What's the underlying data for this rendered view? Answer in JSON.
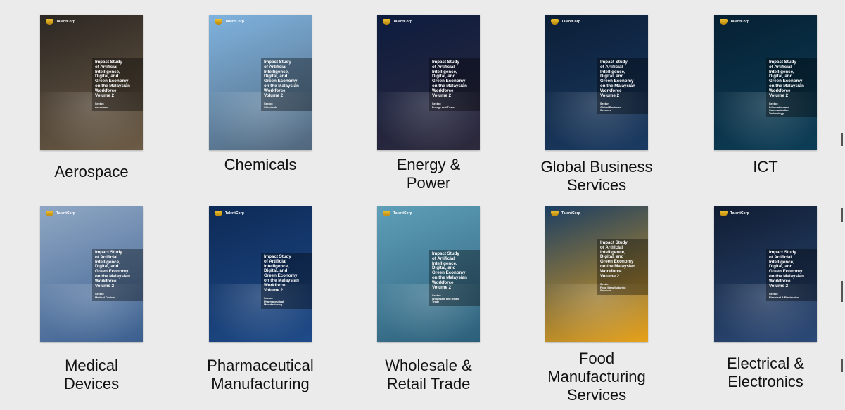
{
  "cover": {
    "brand": "TalentCorp",
    "title": "Impact Study\nof Artificial\nIntelligence,\nDigital, and\nGreen Economy\non the Malaysian\nWorkforce\nVolume 2"
  },
  "reports": [
    {
      "label": "Aerospace",
      "sector": "Sector:\nAerospace",
      "colors": [
        "#2c2723",
        "#6d5c46"
      ]
    },
    {
      "label": "Chemicals",
      "sector": "Sector:\nChemicals",
      "colors": [
        "#7fb3df",
        "#51677c"
      ]
    },
    {
      "label": "Energy &\nPower",
      "sector": "Sector:\nEnergy and Power",
      "colors": [
        "#0d1c3f",
        "#2e2a3d"
      ]
    },
    {
      "label": "Global Business\nServices",
      "sector": "Sector:\nGlobal Business\nServices",
      "colors": [
        "#0b1e37",
        "#1b3b62"
      ]
    },
    {
      "label": "ICT",
      "sector": "Sector:\nInformation and\nCommunication\nTechnology",
      "colors": [
        "#062033",
        "#0d3e57"
      ]
    },
    {
      "label": "Medical\nDevices",
      "sector": "Sector:\nMedical Devices",
      "colors": [
        "#8fa7c4",
        "#3b5f8f"
      ]
    },
    {
      "label": "Pharmaceutical\nManufacturing",
      "sector": "Sector:\nPharmaceutical\nManufacturing",
      "colors": [
        "#0d2a57",
        "#1f4b88"
      ]
    },
    {
      "label": "Wholesale &\nRetail Trade",
      "sector": "Sector:\nWholesale and Retail\nTrade",
      "colors": [
        "#5f9fb8",
        "#2c5f7a"
      ]
    },
    {
      "label": "Food\nManufacturing\nServices",
      "sector": "Sector:\nFood Manufacturing\nServices",
      "colors": [
        "#1c3f63",
        "#e8a21a"
      ]
    },
    {
      "label": "Electrical &\nElectronics",
      "sector": "Sector:\nElectrical & Electronics",
      "colors": [
        "#101d33",
        "#2c4a78"
      ]
    }
  ]
}
